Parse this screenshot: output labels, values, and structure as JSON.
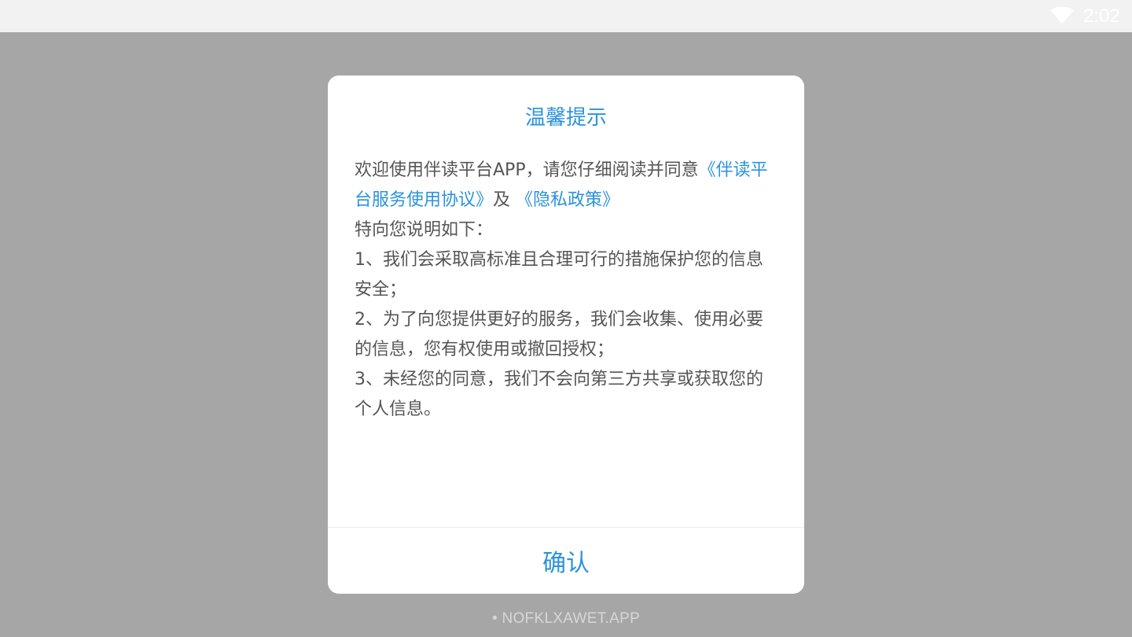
{
  "status_bar": {
    "time": "2:02",
    "wifi_icon": "wifi-icon"
  },
  "dialog": {
    "title": "温馨提示",
    "intro_prefix": "欢迎使用伴读平台APP，请您仔细阅读并同意",
    "link_service": "《伴读平台服务使用协议》",
    "and_text": "及",
    "link_privacy": "《隐私政策》",
    "explain_intro": "特向您说明如下：",
    "items": [
      "1、我们会采取高标准且合理可行的措施保护您的信息安全；",
      "2、为了向您提供更好的服务，我们会收集、使用必要的信息，您有权使用或撤回授权；",
      "3、未经您的同意，我们不会向第三方共享或获取您的个人信息。"
    ],
    "confirm_label": "确认"
  },
  "watermark": "• NOFKLXAWET.APP",
  "colors": {
    "accent": "#2a93dc",
    "overlay": "#a6a6a6",
    "body_text": "#555555"
  }
}
